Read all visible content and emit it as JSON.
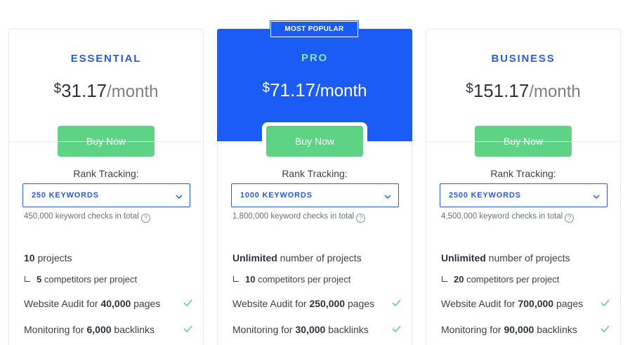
{
  "badge": "MOST POPULAR",
  "plans": [
    {
      "name": "ESSENTIAL",
      "currency": "$",
      "amount": "31.17",
      "period": "/month",
      "buy_label": "Buy Now",
      "rank_label": "Rank Tracking:",
      "keywords": "250 KEYWORDS",
      "checks": "450,000 keyword checks in total",
      "projects_bold": "10",
      "projects_text": " projects",
      "competitors_bold": "5",
      "competitors_text": " competitors per project",
      "audit_prefix": "Website Audit for ",
      "audit_bold": "40,000",
      "audit_suffix": " pages",
      "monitor_prefix": "Monitoring for ",
      "monitor_bold": "6,000",
      "monitor_suffix": " backlinks"
    },
    {
      "name": "PRO",
      "currency": "$",
      "amount": "71.17",
      "period": "/month",
      "buy_label": "Buy Now",
      "rank_label": "Rank Tracking:",
      "keywords": "1000 KEYWORDS",
      "checks": "1,800,000 keyword checks in total",
      "projects_bold": "Unlimited",
      "projects_text": " number of projects",
      "competitors_bold": "10",
      "competitors_text": " competitors per project",
      "audit_prefix": "Website Audit for ",
      "audit_bold": "250,000",
      "audit_suffix": " pages",
      "monitor_prefix": "Monitoring for ",
      "monitor_bold": "30,000",
      "monitor_suffix": " backlinks"
    },
    {
      "name": "BUSINESS",
      "currency": "$",
      "amount": "151.17",
      "period": "/month",
      "buy_label": "Buy Now",
      "rank_label": "Rank Tracking:",
      "keywords": "2500 KEYWORDS",
      "checks": "4,500,000 keyword checks in total",
      "projects_bold": "Unlimited",
      "projects_text": " number of projects",
      "competitors_bold": "20",
      "competitors_text": " competitors per project",
      "audit_prefix": "Website Audit for ",
      "audit_bold": "700,000",
      "audit_suffix": " pages",
      "monitor_prefix": "Monitoring for ",
      "monitor_bold": "90,000",
      "monitor_suffix": " backlinks"
    }
  ],
  "icons": {
    "help": "?",
    "dropdown": "chevron-down-icon",
    "check": "check-icon"
  },
  "colors": {
    "brand_blue": "#1a5cf5",
    "buy_green": "#5ed385",
    "check_green": "#5ed385",
    "plan_title": "#2a5bd7"
  }
}
